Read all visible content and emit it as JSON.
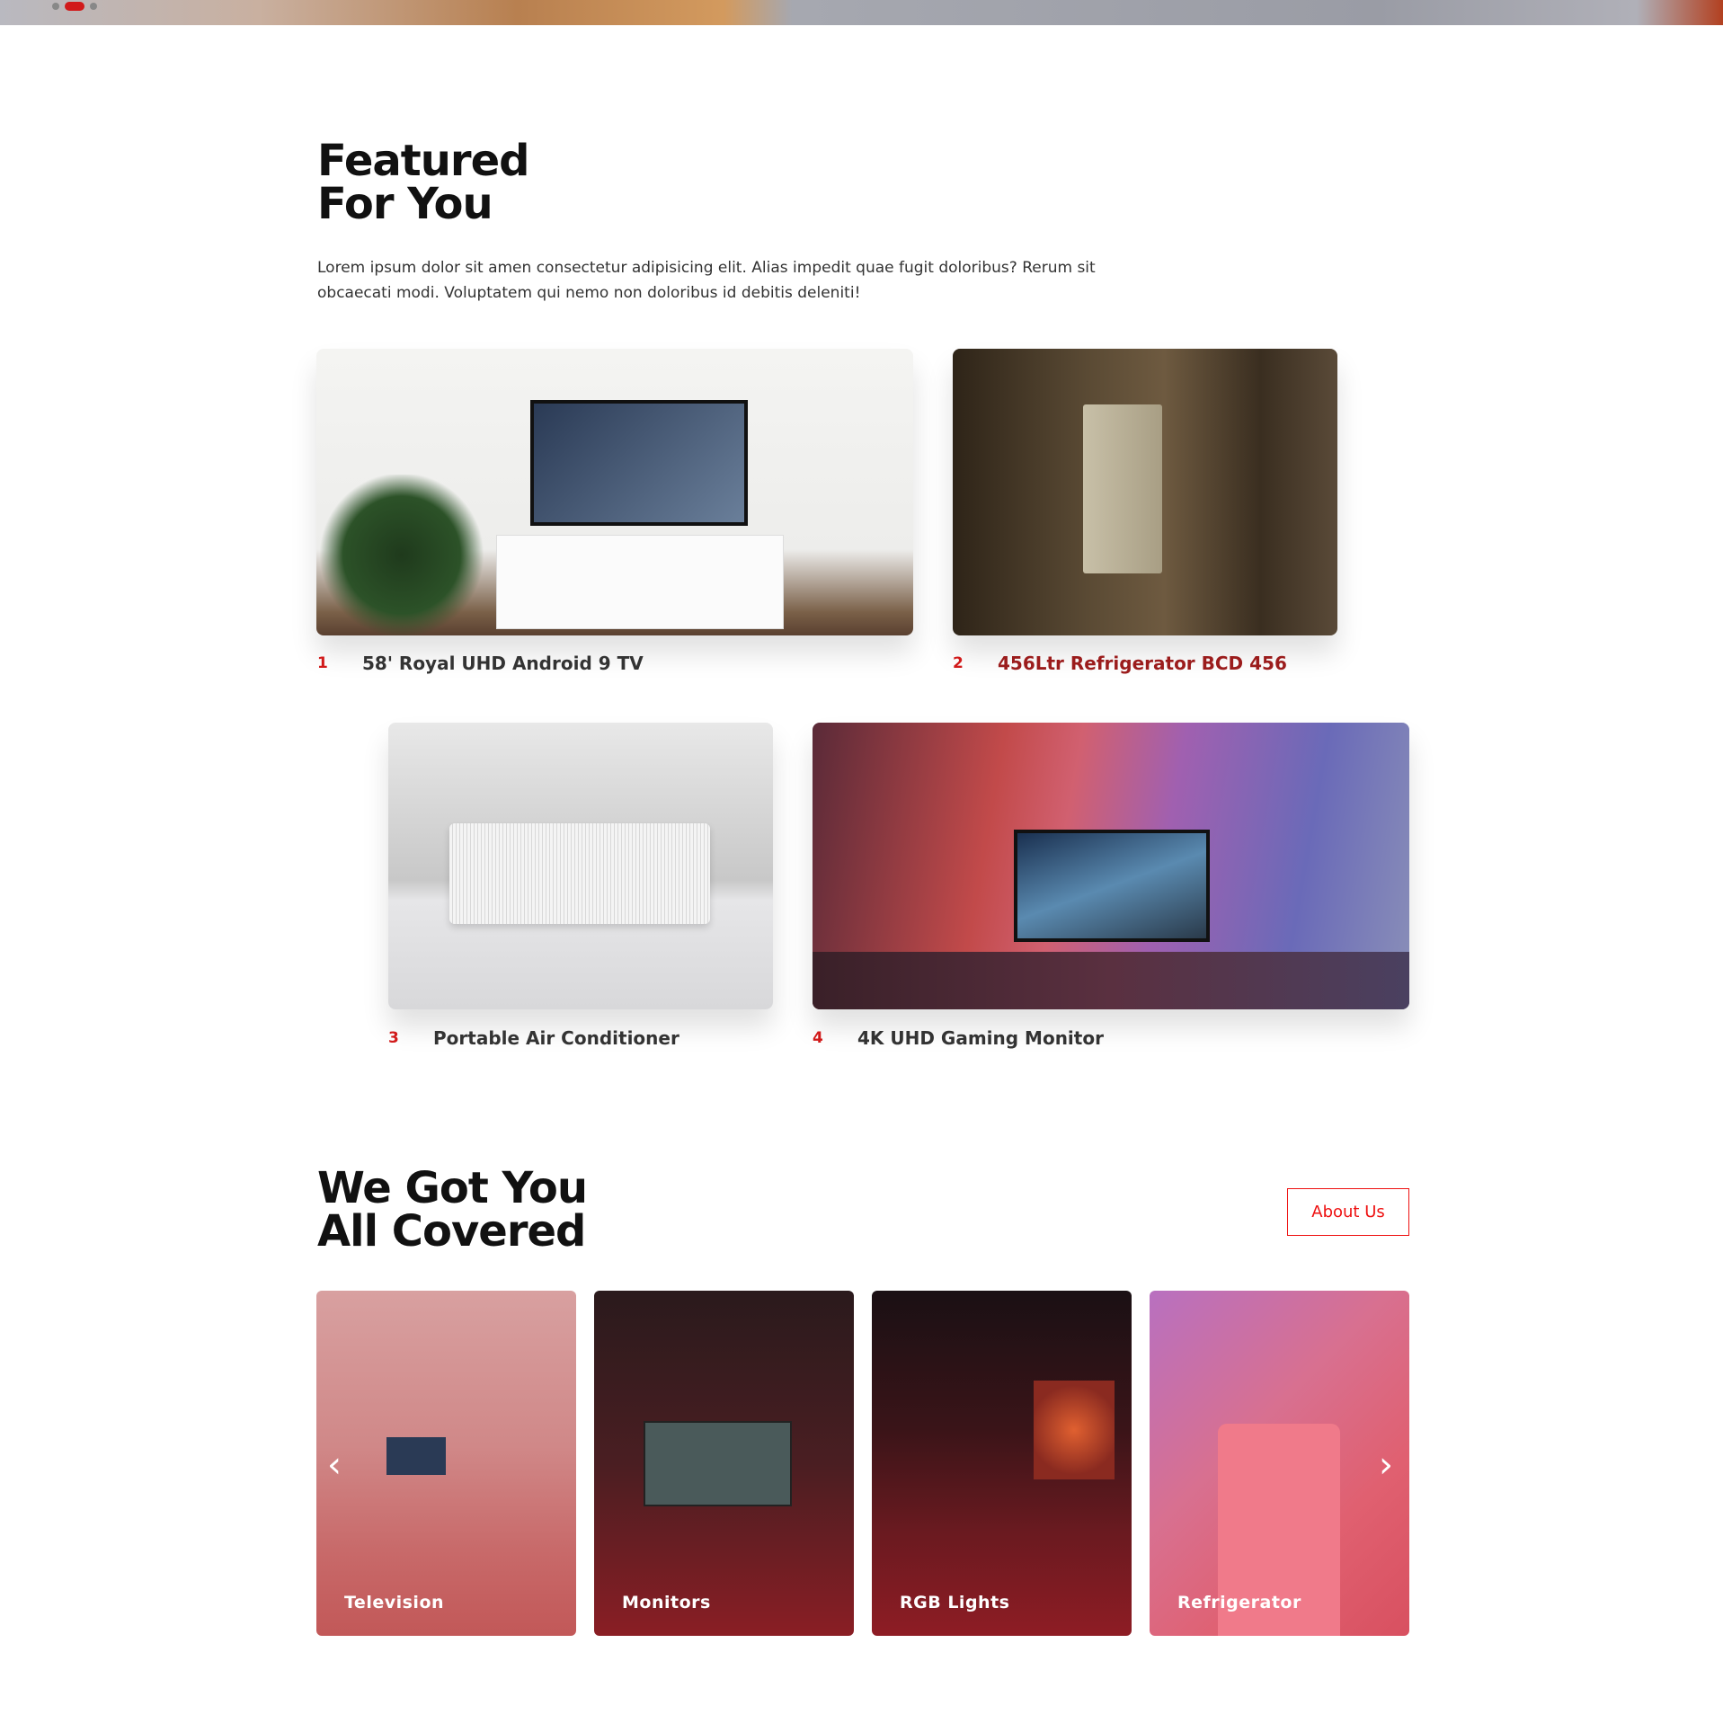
{
  "hero": {
    "slide_count": 3,
    "active_slide": 2
  },
  "featured": {
    "title_line1": "Featured",
    "title_line2": "For You",
    "description": "Lorem ipsum dolor sit amen consectetur adipisicing elit. Alias impedit quae fugit doloribus? Rerum sit obcaecati modi. Voluptatem qui nemo non doloribus id debitis deleniti!",
    "products": [
      {
        "num": "1",
        "name": "58' Royal UHD Android 9 TV"
      },
      {
        "num": "2",
        "name": "456Ltr Refrigerator BCD 456"
      },
      {
        "num": "3",
        "name": "Portable Air Conditioner"
      },
      {
        "num": "4",
        "name": "4K UHD Gaming Monitor"
      }
    ]
  },
  "covered": {
    "title_line1": "We Got You",
    "title_line2": "All Covered",
    "about_label": "About Us",
    "categories": [
      {
        "label": "Television"
      },
      {
        "label": "Monitors"
      },
      {
        "label": "RGB Lights"
      },
      {
        "label": "Refrigerator"
      }
    ],
    "prev_icon": "‹",
    "next_icon": "›"
  },
  "colors": {
    "accent": "#d11a1a"
  }
}
